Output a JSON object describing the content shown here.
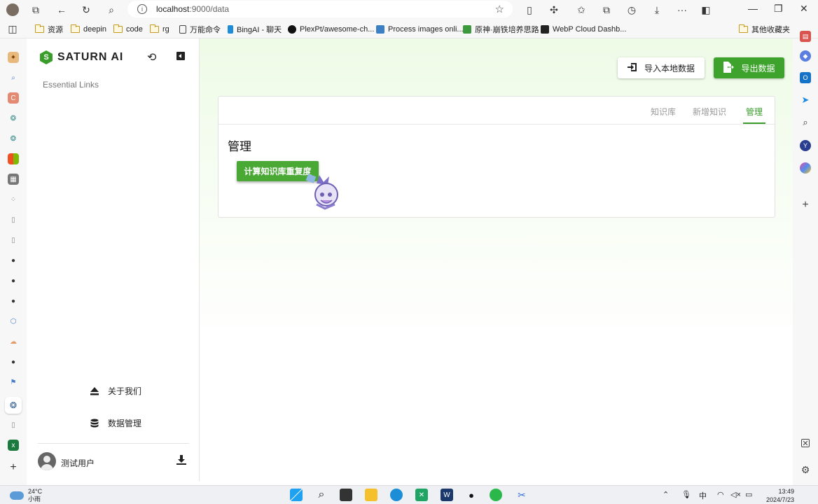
{
  "browser": {
    "url_host": "localhost",
    "url_path": ":9000/data",
    "bookmarks": [
      {
        "label": "资源",
        "type": "folder"
      },
      {
        "label": "deepin",
        "type": "folder"
      },
      {
        "label": "code",
        "type": "folder"
      },
      {
        "label": "rg",
        "type": "folder"
      },
      {
        "label": "万能命令",
        "type": "page"
      },
      {
        "label": "BingAI - 聊天",
        "type": "bing"
      },
      {
        "label": "PlexPt/awesome-ch...",
        "type": "github"
      },
      {
        "label": "Process images onli...",
        "type": "site"
      },
      {
        "label": "原神·崩铁培养思路",
        "type": "site"
      },
      {
        "label": "WebP Cloud Dashb...",
        "type": "site"
      }
    ],
    "other_bookmarks": "其他收藏夹"
  },
  "sidebar": {
    "brand": "SATURN AI",
    "essential_links": "Essential Links",
    "items": [
      {
        "label": "关于我们",
        "icon": "eject-icon"
      },
      {
        "label": "数据管理",
        "icon": "database-icon"
      }
    ],
    "user_name": "测试用户"
  },
  "main": {
    "import_label": "导入本地数据",
    "export_label": "导出数据",
    "tabs": [
      {
        "label": "知识库",
        "active": false
      },
      {
        "label": "新增知识",
        "active": false
      },
      {
        "label": "管理",
        "active": true
      }
    ],
    "section_title": "管理",
    "calc_button": "计算知识库重复度"
  },
  "taskbar": {
    "temperature": "24°C",
    "weather": "小雨",
    "ime": "中",
    "time": "13:49",
    "date": "2024/7/23"
  },
  "colors": {
    "accent": "#3a9d2b",
    "export_button": "#3ea32c",
    "calc_button": "#4aa834"
  }
}
